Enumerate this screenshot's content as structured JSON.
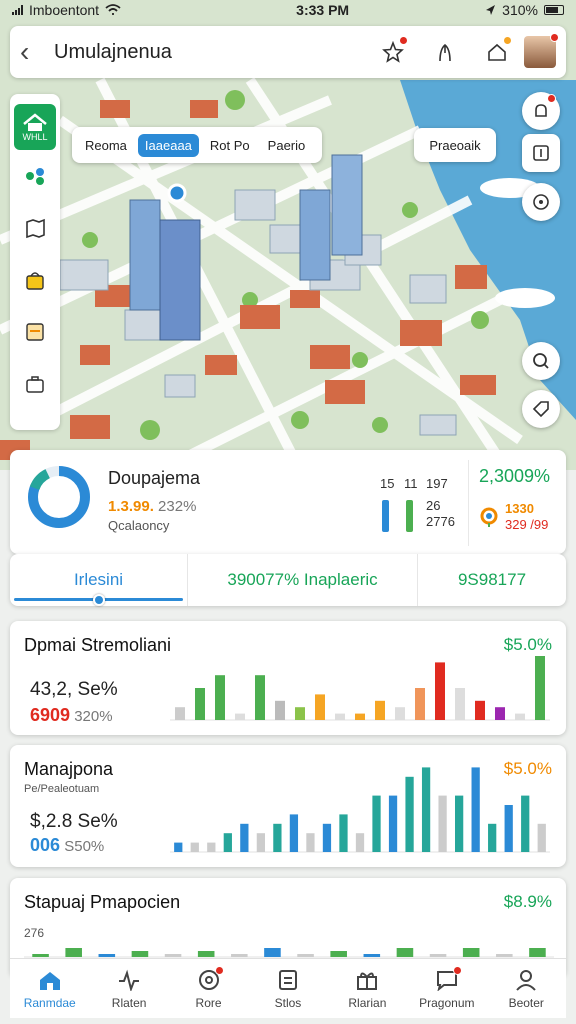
{
  "status": {
    "carrier": "Imboentont",
    "time": "3:33 PM",
    "battery": "310%"
  },
  "header": {
    "title": "Umulajnenua",
    "back_icon": "back-arrow-icon"
  },
  "map": {
    "chips": [
      "Reoma",
      "Iaaeaaa",
      "Rot Po",
      "Paerio"
    ],
    "active_chip": 1,
    "tag_label": "Praeoaik",
    "sidebar_home_label": "WHLL"
  },
  "summary": {
    "title": "Doupajema",
    "value_main": "1.3.99.",
    "value_pct": "232%",
    "subtitle": "Qcalaoncy",
    "mini_top": [
      "15",
      "11",
      "197"
    ],
    "mini_nums": [
      "26",
      "2776"
    ],
    "side_pct": "2,3009%",
    "side_val1": "1330",
    "side_val2": "329 /99",
    "donut_fraction": 0.82
  },
  "tabs": {
    "tab1": "Irlesini",
    "tab2": "390077% Inaplaeric",
    "tab3": "9S98177",
    "slider_level": 0.5
  },
  "stat1": {
    "title": "Dpmai Stremoliani",
    "pct": "$5.0%",
    "l1": "43,2, Se%",
    "l2_bold": "6909",
    "l2": "320%"
  },
  "stat2": {
    "title": "Manajpona",
    "subtitle": "Pe/Pealeotuam",
    "pct": "$5.0%",
    "l1": "$,2.8 Se%",
    "l2_bold": "006",
    "l2": "S50%"
  },
  "stat3": {
    "title": "Stapuaj Pmapocien",
    "pct": "$8.9%",
    "l1": "276"
  },
  "nav": [
    {
      "label": "Ranmdae",
      "icon": "home-icon"
    },
    {
      "label": "Rlaten",
      "icon": "activity-icon"
    },
    {
      "label": "Rore",
      "icon": "target-icon"
    },
    {
      "label": "Stlos",
      "icon": "document-icon"
    },
    {
      "label": "Rlarian",
      "icon": "gift-icon"
    },
    {
      "label": "Pragonum",
      "icon": "chat-icon"
    },
    {
      "label": "Beoter",
      "icon": "profile-icon"
    }
  ],
  "chart_data": [
    {
      "type": "bar",
      "values": [
        2,
        5,
        7,
        1,
        7,
        3,
        2,
        4,
        1,
        1,
        3,
        2,
        5,
        9,
        5,
        3,
        2,
        1,
        10
      ],
      "colors": [
        "#cccccc",
        "#4caf50",
        "#4caf50",
        "#dddddd",
        "#4caf50",
        "#bbbbbb",
        "#8bc34a",
        "#f5a524",
        "#dddddd",
        "#f5a524",
        "#f5a524",
        "#dddddd",
        "#f0955a",
        "#e02b20",
        "#dddddd",
        "#e02b20",
        "#9c27b0",
        "#dddddd",
        "#4caf50"
      ],
      "ylim": [
        0,
        10
      ]
    },
    {
      "type": "bar",
      "values": [
        1,
        1,
        1,
        2,
        3,
        2,
        3,
        4,
        2,
        3,
        4,
        2,
        6,
        6,
        8,
        9,
        6,
        6,
        9,
        3,
        5,
        6,
        3
      ],
      "colors": [
        "#2b8ad6",
        "#cccccc",
        "#cccccc",
        "#26a69a",
        "#2b8ad6",
        "#cccccc",
        "#26a69a",
        "#2b8ad6",
        "#cccccc",
        "#2b8ad6",
        "#26a69a",
        "#cccccc",
        "#26a69a",
        "#2b8ad6",
        "#26a69a",
        "#26a69a",
        "#cccccc",
        "#26a69a",
        "#2b8ad6",
        "#26a69a",
        "#2b8ad6",
        "#26a69a",
        "#cccccc"
      ],
      "ylim": [
        0,
        10
      ]
    },
    {
      "type": "bar",
      "values": [
        1,
        3,
        1,
        2,
        1,
        2,
        1,
        3,
        1,
        2,
        1,
        3,
        1,
        3,
        1,
        3
      ],
      "colors": [
        "#4caf50",
        "#4caf50",
        "#2b8ad6",
        "#4caf50",
        "#cccccc",
        "#4caf50",
        "#cccccc",
        "#2b8ad6",
        "#cccccc",
        "#4caf50",
        "#2b8ad6",
        "#4caf50",
        "#cccccc",
        "#4caf50",
        "#cccccc",
        "#4caf50"
      ],
      "ylim": [
        0,
        10
      ]
    }
  ]
}
